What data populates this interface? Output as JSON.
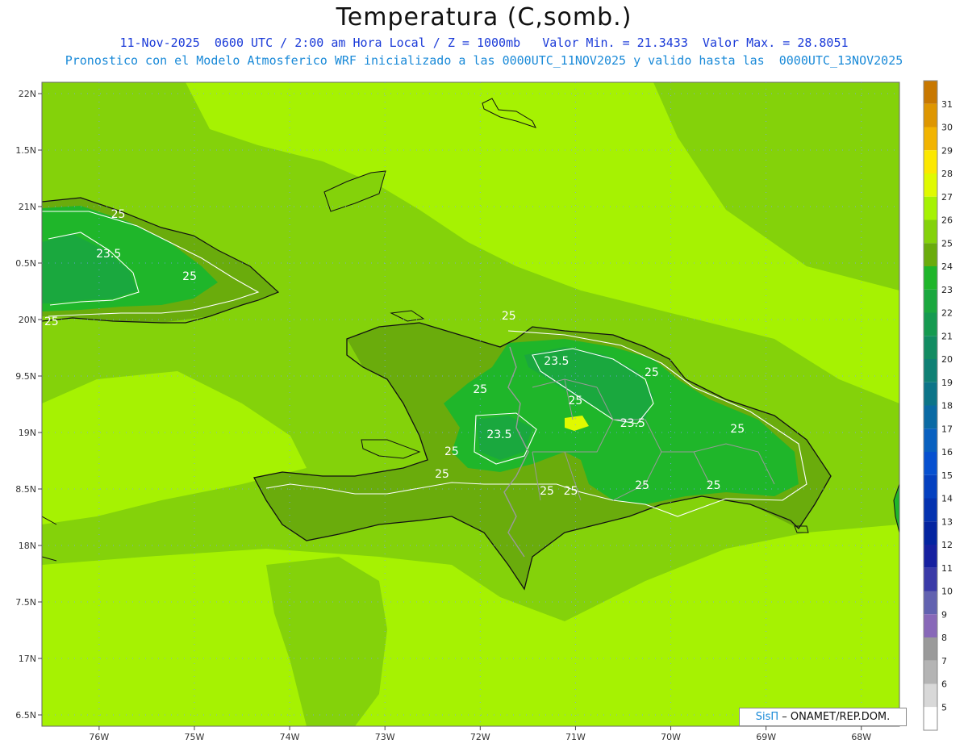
{
  "title": "Temperatura (C,somb.)",
  "subtitle_line1": "11-Nov-2025  0600 UTC / 2:00 am Hora Local / Z = 1000mb   Valor Min. = 21.3433  Valor Max. = 28.8051",
  "subtitle_line2": "Pronostico con el Modelo Atmosferico WRF inicializado a las 0000UTC_11NOV2025 y valido hasta las  0000UTC_13NOV2025",
  "credit": {
    "logo": "SisΠ",
    "text": "– ONAMET/REP.DOM."
  },
  "colors": {
    "subtitle1": "#1a3ad8",
    "subtitle2": "#1a8ad8",
    "sea_warm": "#a6f202",
    "land_cool": "#1fa82a"
  },
  "map": {
    "lon_range": [
      -76.6,
      -67.6
    ],
    "lat_range": [
      16.4,
      22.1
    ],
    "lon_ticks": [
      {
        "value": -76,
        "label": "76W"
      },
      {
        "value": -75,
        "label": "75W"
      },
      {
        "value": -74,
        "label": "74W"
      },
      {
        "value": -73,
        "label": "73W"
      },
      {
        "value": -72,
        "label": "72W"
      },
      {
        "value": -71,
        "label": "71W"
      },
      {
        "value": -70,
        "label": "70W"
      },
      {
        "value": -69,
        "label": "69W"
      },
      {
        "value": -68,
        "label": "68W"
      }
    ],
    "lat_ticks": [
      {
        "value": 22,
        "label": "22N"
      },
      {
        "value": 21.5,
        "label": "1.5N"
      },
      {
        "value": 21,
        "label": "21N"
      },
      {
        "value": 20.5,
        "label": "0.5N"
      },
      {
        "value": 20,
        "label": "20N"
      },
      {
        "value": 19.5,
        "label": "9.5N"
      },
      {
        "value": 19,
        "label": "19N"
      },
      {
        "value": 18.5,
        "label": "8.5N"
      },
      {
        "value": 18,
        "label": "18N"
      },
      {
        "value": 17.5,
        "label": "7.5N"
      },
      {
        "value": 17,
        "label": "17N"
      },
      {
        "value": 16.5,
        "label": "6.5N"
      }
    ],
    "contour_labels": [
      {
        "text": "25",
        "lon": -75.8,
        "lat": 20.9
      },
      {
        "text": "23.5",
        "lon": -75.9,
        "lat": 20.55
      },
      {
        "text": "25",
        "lon": -75.05,
        "lat": 20.35
      },
      {
        "text": "25",
        "lon": -76.5,
        "lat": 19.95
      },
      {
        "text": "25",
        "lon": -71.7,
        "lat": 20.0
      },
      {
        "text": "23.5",
        "lon": -71.2,
        "lat": 19.6
      },
      {
        "text": "25",
        "lon": -70.2,
        "lat": 19.5
      },
      {
        "text": "25",
        "lon": -72.0,
        "lat": 19.35
      },
      {
        "text": "25",
        "lon": -71.0,
        "lat": 19.25
      },
      {
        "text": "23.5",
        "lon": -70.4,
        "lat": 19.05
      },
      {
        "text": "25",
        "lon": -69.3,
        "lat": 19.0
      },
      {
        "text": "23.5",
        "lon": -71.8,
        "lat": 18.95
      },
      {
        "text": "25",
        "lon": -72.3,
        "lat": 18.8
      },
      {
        "text": "25",
        "lon": -72.4,
        "lat": 18.6
      },
      {
        "text": "25",
        "lon": -71.3,
        "lat": 18.45
      },
      {
        "text": "25",
        "lon": -71.05,
        "lat": 18.45
      },
      {
        "text": "25",
        "lon": -70.3,
        "lat": 18.5
      },
      {
        "text": "25",
        "lon": -69.55,
        "lat": 18.5
      }
    ]
  },
  "colorbar": {
    "levels": [
      31,
      30,
      29,
      28,
      27,
      26,
      25,
      24,
      23,
      22,
      21,
      20,
      19,
      18,
      17,
      16,
      15,
      14,
      13,
      12,
      11,
      10,
      9,
      8,
      7,
      6,
      5
    ],
    "colors": [
      "#c87800",
      "#de9600",
      "#f2b400",
      "#fce800",
      "#e0fa00",
      "#a6f202",
      "#84d20a",
      "#6aac0c",
      "#1fb62a",
      "#1aa83e",
      "#159a50",
      "#128c62",
      "#0f8074",
      "#0c7488",
      "#0a6aa4",
      "#0860c0",
      "#0650d0",
      "#0440c0",
      "#0432b0",
      "#0424a0",
      "#1620a0",
      "#3a3aa8",
      "#6262b0",
      "#8868b8",
      "#9a9a9a",
      "#b4b4b4",
      "#d8d8d8",
      "#ffffff"
    ]
  }
}
